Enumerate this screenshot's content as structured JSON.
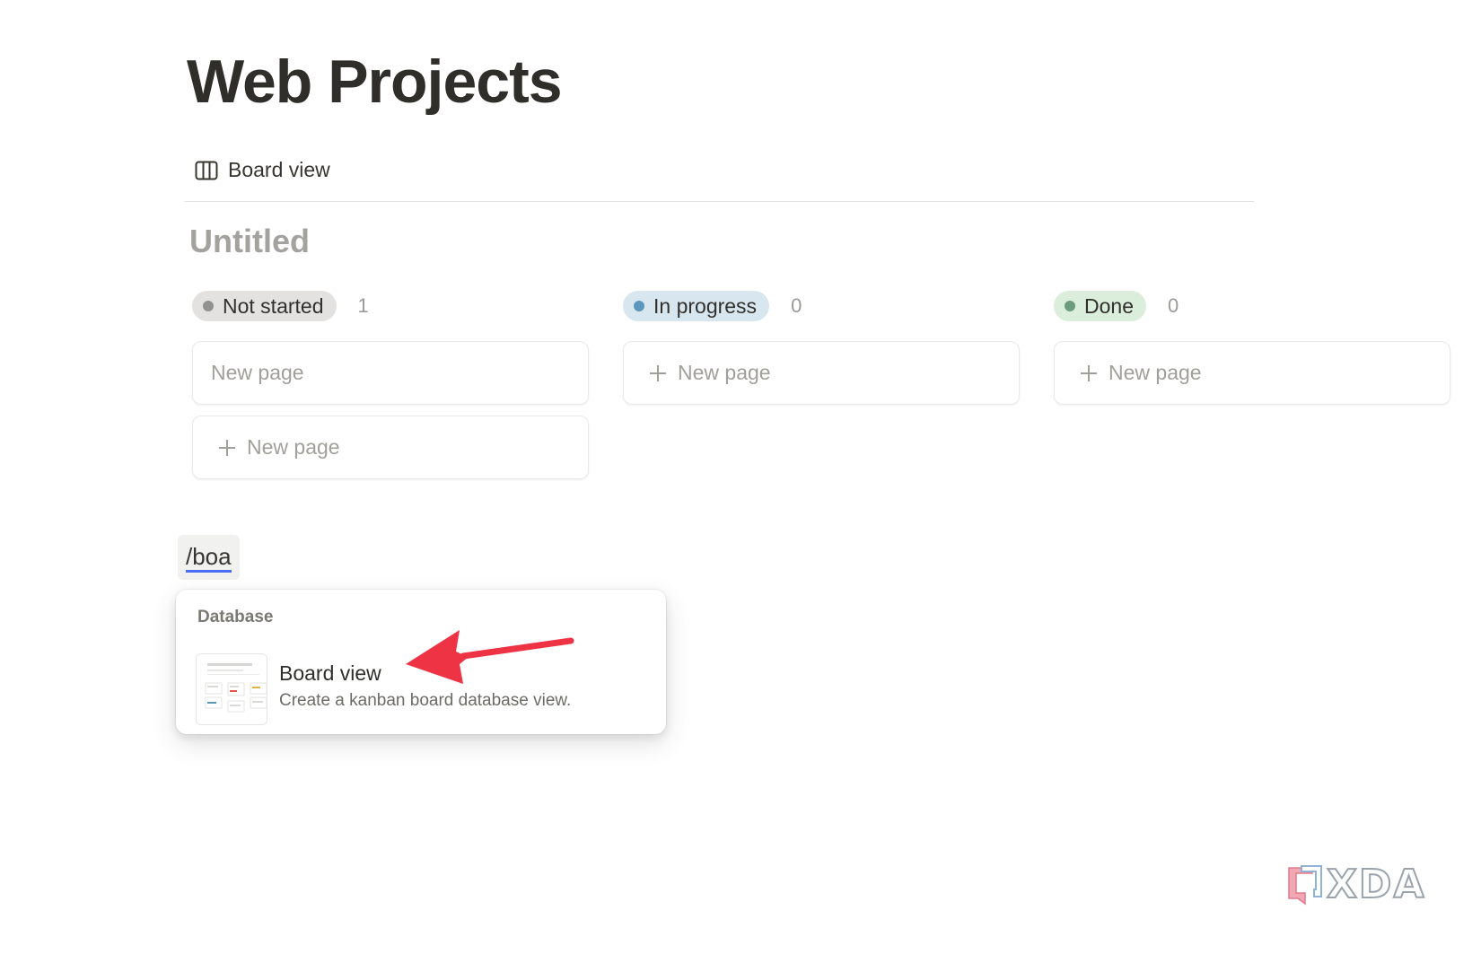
{
  "page": {
    "title": "Web Projects"
  },
  "view_tab": {
    "icon": "board-view-icon",
    "label": "Board view"
  },
  "database": {
    "title": "Untitled"
  },
  "columns": [
    {
      "status": "Not started",
      "count": "1",
      "pill_color": "#e3e2e0",
      "dot_color": "#91918e",
      "cards": [
        {
          "label": "New page",
          "is_add": false
        },
        {
          "label": "New page",
          "is_add": true
        }
      ]
    },
    {
      "status": "In progress",
      "count": "0",
      "pill_color": "#d8e6f0",
      "dot_color": "#5b97bd",
      "cards": [
        {
          "label": "New page",
          "is_add": true
        }
      ]
    },
    {
      "status": "Done",
      "count": "0",
      "pill_color": "#dbeddb",
      "dot_color": "#6c9b7d",
      "cards": [
        {
          "label": "New page",
          "is_add": true
        }
      ]
    }
  ],
  "slash_command": {
    "typed": "/boa"
  },
  "menu": {
    "section": "Database",
    "item": {
      "title": "Board view",
      "description": "Create a kanban board database view."
    }
  },
  "annotation": {
    "arrow_color": "#ee3344"
  },
  "watermark": {
    "text": "XDA"
  }
}
